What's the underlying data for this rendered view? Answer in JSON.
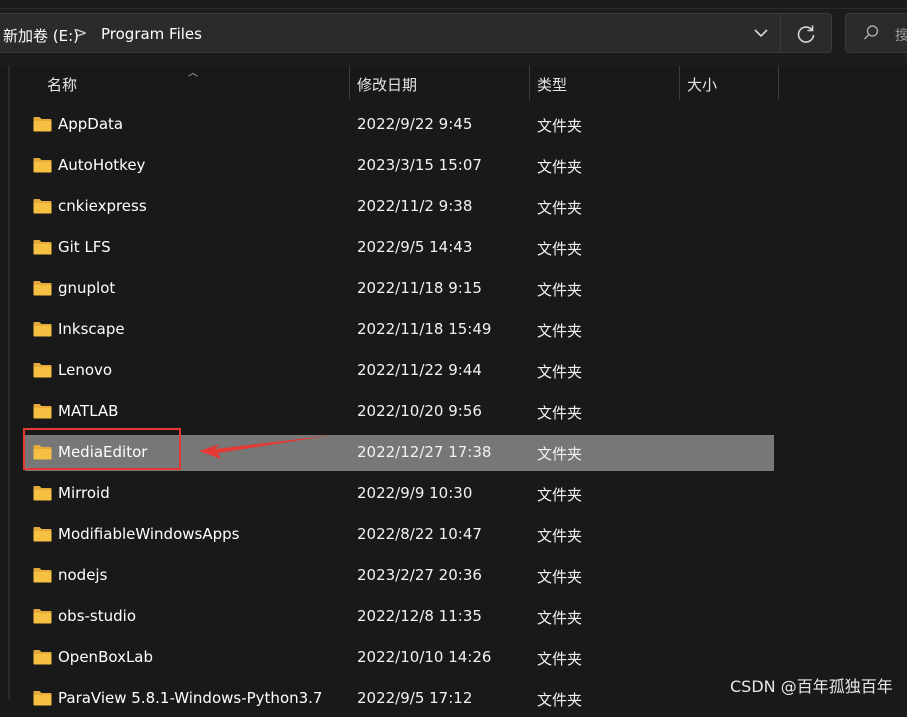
{
  "address": {
    "drive": "新加卷 (E:)",
    "separator": ">",
    "folder": "Program Files"
  },
  "search": {
    "placeholder": "搜"
  },
  "columns": {
    "name": "名称",
    "date": "修改日期",
    "type": "类型",
    "size": "大小"
  },
  "rows": [
    {
      "name": "AppData",
      "date": "2022/9/22 9:45",
      "type": "文件夹"
    },
    {
      "name": "AutoHotkey",
      "date": "2023/3/15 15:07",
      "type": "文件夹"
    },
    {
      "name": "cnkiexpress",
      "date": "2022/11/2 9:38",
      "type": "文件夹"
    },
    {
      "name": "Git LFS",
      "date": "2022/9/5 14:43",
      "type": "文件夹"
    },
    {
      "name": "gnuplot",
      "date": "2022/11/18 9:15",
      "type": "文件夹"
    },
    {
      "name": "Inkscape",
      "date": "2022/11/18 15:49",
      "type": "文件夹"
    },
    {
      "name": "Lenovo",
      "date": "2022/11/22 9:44",
      "type": "文件夹"
    },
    {
      "name": "MATLAB",
      "date": "2022/10/20 9:56",
      "type": "文件夹"
    },
    {
      "name": "MediaEditor",
      "date": "2022/12/27 17:38",
      "type": "文件夹",
      "selected": true
    },
    {
      "name": "Mirroid",
      "date": "2022/9/9 10:30",
      "type": "文件夹"
    },
    {
      "name": "ModifiableWindowsApps",
      "date": "2022/8/22 10:47",
      "type": "文件夹"
    },
    {
      "name": "nodejs",
      "date": "2023/2/27 20:36",
      "type": "文件夹"
    },
    {
      "name": "obs-studio",
      "date": "2022/12/8 11:35",
      "type": "文件夹"
    },
    {
      "name": "OpenBoxLab",
      "date": "2022/10/10 14:26",
      "type": "文件夹"
    },
    {
      "name": "ParaView 5.8.1-Windows-Python3.7",
      "date": "2022/9/5 17:12",
      "type": "文件夹"
    }
  ],
  "watermark": "CSDN @百年孤独百年",
  "colors": {
    "selected_row": "#777777",
    "annotation_red": "#e53935",
    "folder_yellow": "#f6c142"
  }
}
